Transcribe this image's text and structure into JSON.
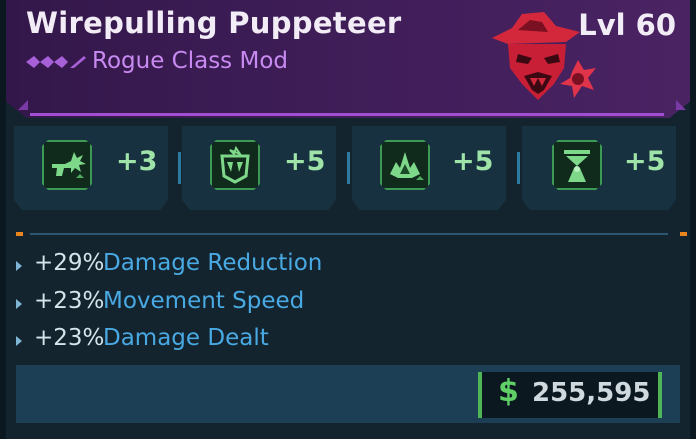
{
  "item": {
    "name": "Wirepulling Puppeteer",
    "type": "Rogue Class Mod",
    "level": "Lvl 60",
    "emblem_icon": "masked-rogue-skull-emblem",
    "rarity_icon": "purple-rarity-chevrons",
    "accent_color": "#c88af0"
  },
  "skills": [
    {
      "icon": "pistol-burst-icon",
      "value": "+3"
    },
    {
      "icon": "fanged-mouth-icon",
      "value": "+5"
    },
    {
      "icon": "green-flame-icon",
      "value": "+5"
    },
    {
      "icon": "hourglass-figure-icon",
      "value": "+5"
    }
  ],
  "stats": [
    {
      "value": "+29%",
      "label": "Damage Reduction"
    },
    {
      "value": "+23%",
      "label": "Movement Speed"
    },
    {
      "value": "+23%",
      "label": "Damage Dealt"
    }
  ],
  "price": {
    "currency_icon": "dollar-icon",
    "symbol": "$",
    "value": "255,595",
    "color": "#5fcf66"
  }
}
